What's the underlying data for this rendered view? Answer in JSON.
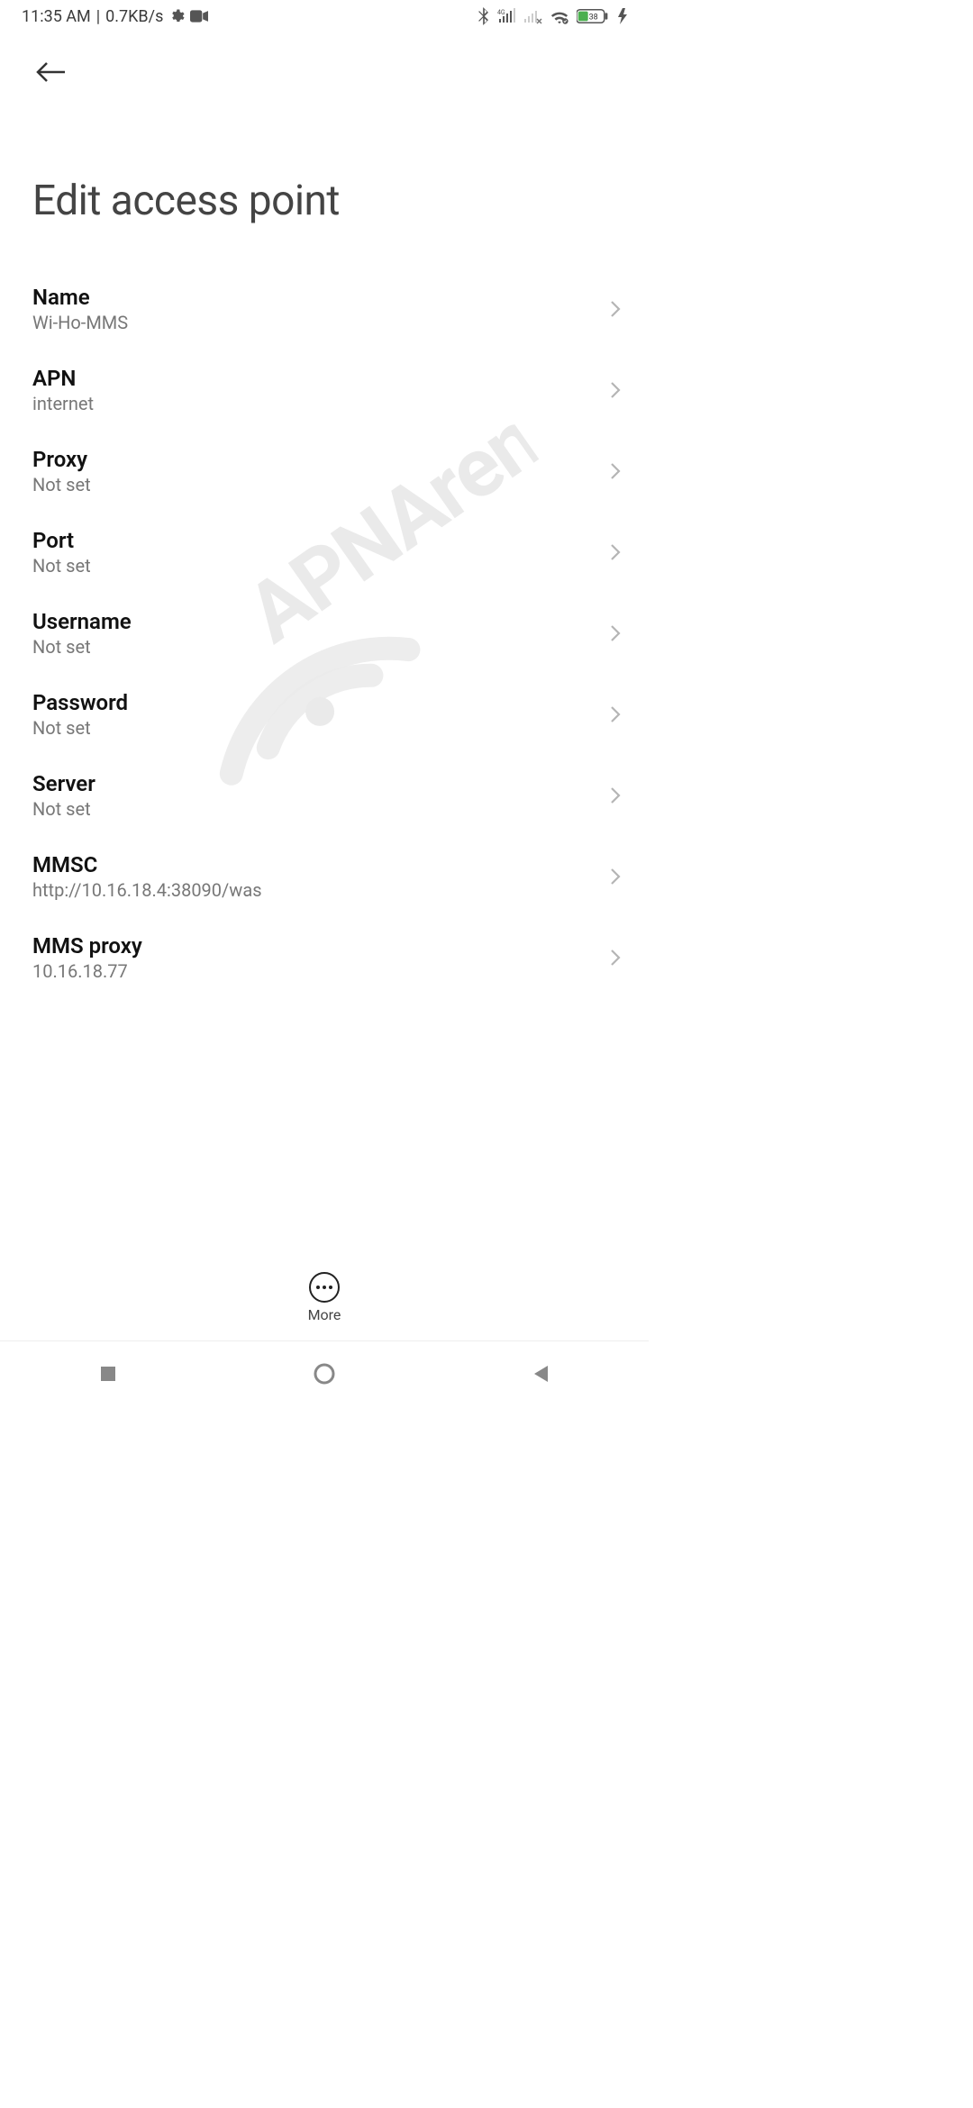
{
  "status_bar": {
    "time": "11:35 AM",
    "separator": "|",
    "speed": "0.7KB/s",
    "battery_percent": "38"
  },
  "header": {
    "title": "Edit access point"
  },
  "settings": [
    {
      "label": "Name",
      "value": "Wi-Ho-MMS"
    },
    {
      "label": "APN",
      "value": "internet"
    },
    {
      "label": "Proxy",
      "value": "Not set"
    },
    {
      "label": "Port",
      "value": "Not set"
    },
    {
      "label": "Username",
      "value": "Not set"
    },
    {
      "label": "Password",
      "value": "Not set"
    },
    {
      "label": "Server",
      "value": "Not set"
    },
    {
      "label": "MMSC",
      "value": "http://10.16.18.4:38090/was"
    },
    {
      "label": "MMS proxy",
      "value": "10.16.18.77"
    }
  ],
  "action_bar": {
    "more_label": "More"
  },
  "watermark": {
    "text": "APNArena"
  }
}
